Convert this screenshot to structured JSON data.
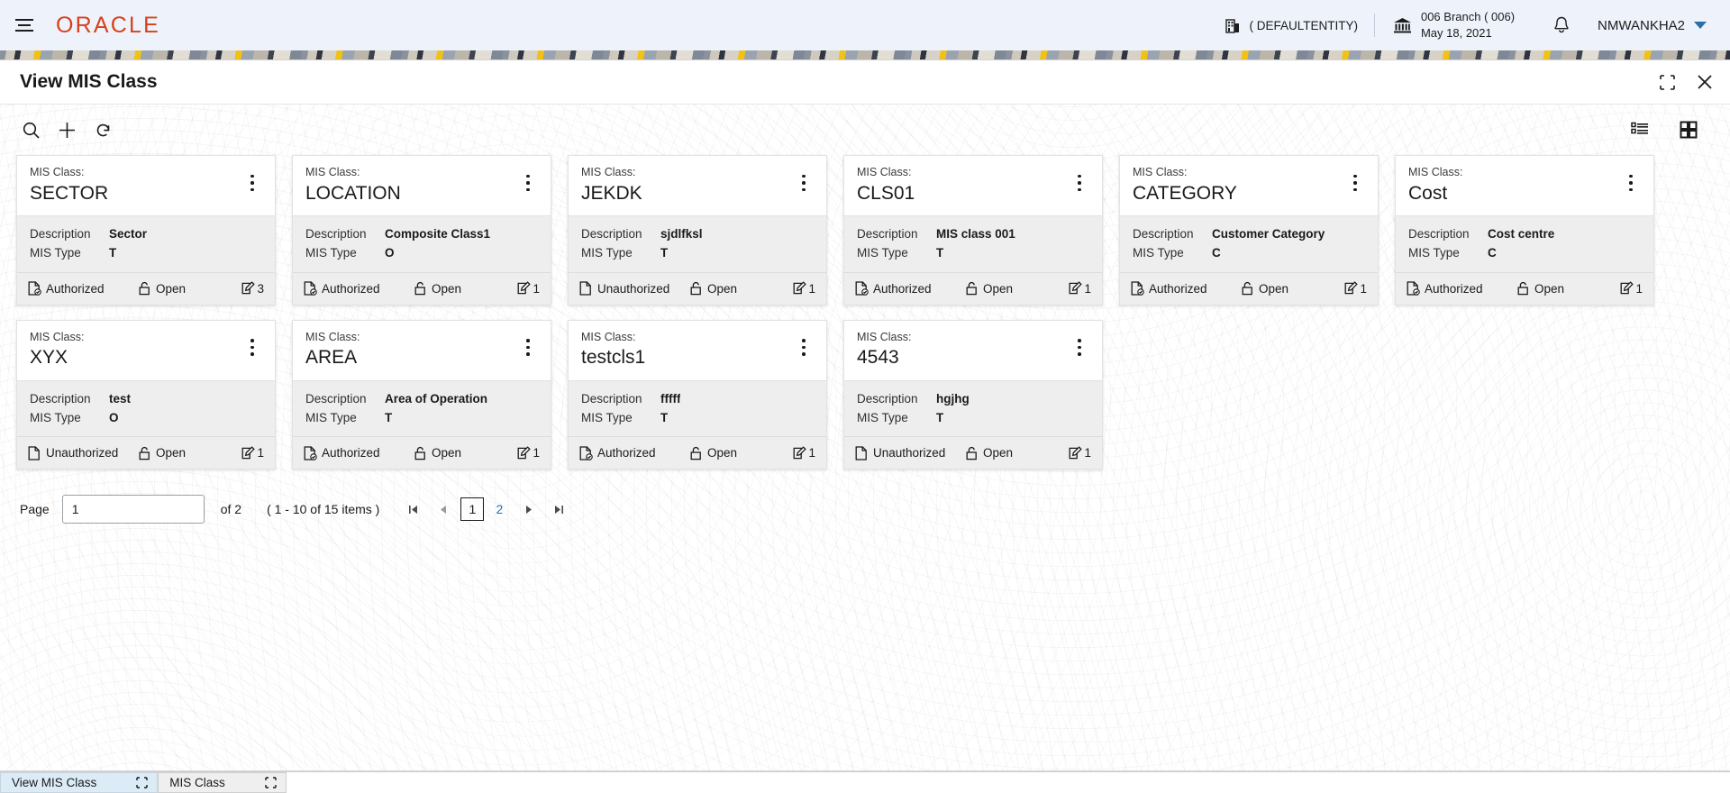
{
  "appbar": {
    "brand": "ORACLE",
    "entity": "( DEFAULTENTITY)",
    "branch_name": "006 Branch ( 006)",
    "branch_date": "May 18, 2021",
    "user": "NMWANKHA2",
    "icons": {
      "menu": "hamburger-icon",
      "entity": "building-icon",
      "branch": "bank-icon",
      "notifications": "bell-icon",
      "user_chevron": "chevron-down-icon"
    }
  },
  "window": {
    "title": "View MIS Class",
    "minimize_label": "minimize",
    "close_label": "close"
  },
  "toolbar": {
    "search_label": "Search",
    "add_label": "Add",
    "refresh_label": "Refresh",
    "list_view_label": "List View",
    "tile_view_label": "Tile View"
  },
  "card_labels": {
    "title_prefix": "MIS Class:",
    "description": "Description",
    "mis_type": "MIS Type"
  },
  "cards": [
    {
      "mis_class": "SECTOR",
      "description": "Sector",
      "mis_type": "T",
      "auth_status": "Authorized",
      "record_state": "Open",
      "mod_count": "3"
    },
    {
      "mis_class": "LOCATION",
      "description": "Composite Class1",
      "mis_type": "O",
      "auth_status": "Authorized",
      "record_state": "Open",
      "mod_count": "1"
    },
    {
      "mis_class": "JEKDK",
      "description": "sjdlfksl",
      "mis_type": "T",
      "auth_status": "Unauthorized",
      "record_state": "Open",
      "mod_count": "1"
    },
    {
      "mis_class": "CLS01",
      "description": "MIS class 001",
      "mis_type": "T",
      "auth_status": "Authorized",
      "record_state": "Open",
      "mod_count": "1"
    },
    {
      "mis_class": "CATEGORY",
      "description": "Customer Category",
      "mis_type": "C",
      "auth_status": "Authorized",
      "record_state": "Open",
      "mod_count": "1"
    },
    {
      "mis_class": "Cost",
      "description": "Cost centre",
      "mis_type": "C",
      "auth_status": "Authorized",
      "record_state": "Open",
      "mod_count": "1"
    },
    {
      "mis_class": "XYX",
      "description": "test",
      "mis_type": "O",
      "auth_status": "Unauthorized",
      "record_state": "Open",
      "mod_count": "1"
    },
    {
      "mis_class": "AREA",
      "description": "Area of Operation",
      "mis_type": "T",
      "auth_status": "Authorized",
      "record_state": "Open",
      "mod_count": "1"
    },
    {
      "mis_class": "testcls1",
      "description": "fffff",
      "mis_type": "T",
      "auth_status": "Authorized",
      "record_state": "Open",
      "mod_count": "1"
    },
    {
      "mis_class": "4543",
      "description": "hgjhg",
      "mis_type": "T",
      "auth_status": "Unauthorized",
      "record_state": "Open",
      "mod_count": "1"
    }
  ],
  "pagination": {
    "page_label": "Page",
    "page_value": "1",
    "of_text": "of 2",
    "items_text": "( 1 - 10 of 15 items )",
    "first_label": "|<",
    "prev_label": "◀",
    "next_label": "▶",
    "last_label": ">|",
    "pages": [
      {
        "num": "1",
        "active": true
      },
      {
        "num": "2",
        "active": false
      }
    ]
  },
  "taskbar": {
    "tabs": [
      {
        "label": "View MIS Class",
        "active": true
      },
      {
        "label": "MIS Class",
        "active": false
      }
    ]
  },
  "colors": {
    "brand_red": "#d8401b",
    "appbar_bg": "#eef2fb",
    "link_blue": "#1a73c4",
    "card_body_gray": "#eeeeee",
    "active_tab_blue": "#dcecf7"
  }
}
